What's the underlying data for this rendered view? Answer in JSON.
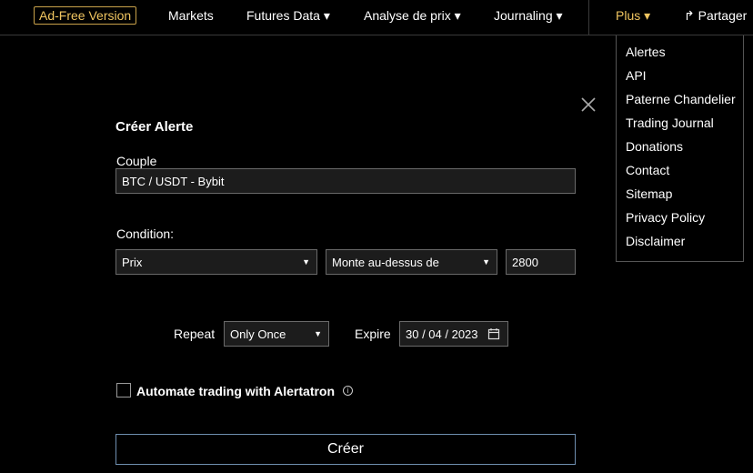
{
  "nav": {
    "adfree": "Ad-Free Version",
    "markets": "Markets",
    "futures": "Futures Data ▾",
    "analyse": "Analyse de prix ▾",
    "journaling": "Journaling ▾",
    "plus": "Plus ▾",
    "share": "↱ Partager"
  },
  "dropdown": {
    "items": [
      "Alertes",
      "API",
      "Paterne Chandelier",
      "Trading Journal",
      "Donations",
      "Contact",
      "Sitemap",
      "Privacy Policy",
      "Disclaimer"
    ]
  },
  "form": {
    "title": "Créer Alerte",
    "couple_label": "Couple",
    "couple_value": "BTC / USDT - Bybit",
    "condition_label": "Condition:",
    "type_value": "Prix",
    "direction_value": "Monte au-dessus de",
    "price_value": "2800",
    "repeat_label": "Repeat",
    "repeat_value": "Only Once",
    "expire_label": "Expire",
    "expire_value": "30 / 04 / 2023",
    "automate_label": "Automate trading with Alertatron",
    "create_label": "Créer"
  }
}
